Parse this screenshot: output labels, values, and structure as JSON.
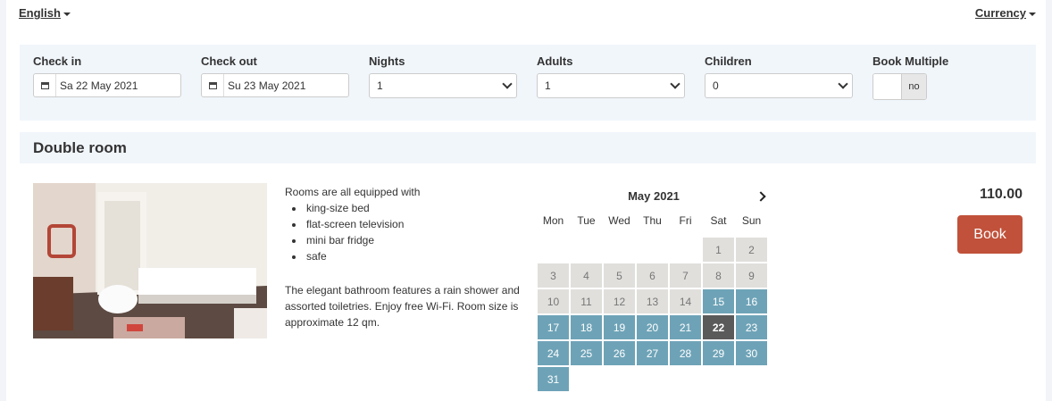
{
  "header": {
    "language": "English",
    "currency": "Currency"
  },
  "search": {
    "checkin": {
      "label": "Check in",
      "value": "Sa 22 May 2021"
    },
    "checkout": {
      "label": "Check out",
      "value": "Su 23 May 2021"
    },
    "nights": {
      "label": "Nights",
      "value": "1"
    },
    "adults": {
      "label": "Adults",
      "value": "1"
    },
    "children": {
      "label": "Children",
      "value": "0"
    },
    "book_multiple": {
      "label": "Book Multiple",
      "value": "no"
    }
  },
  "room": {
    "title": "Double room",
    "intro": "Rooms are all equipped with",
    "amenities": [
      "king-size bed",
      "flat-screen television",
      "mini bar fridge",
      "safe"
    ],
    "description": "The elegant bathroom features a rain shower and assorted toiletries. Enjoy free Wi-Fi. Room size is approximate 12 qm.",
    "price": "110.00",
    "book_label": "Book"
  },
  "calendar": {
    "title": "May 2021",
    "weekdays": [
      "Mon",
      "Tue",
      "Wed",
      "Thu",
      "Fri",
      "Sat",
      "Sun"
    ],
    "weeks": [
      [
        "",
        "",
        "",
        "",
        "",
        "1",
        "2"
      ],
      [
        "3",
        "4",
        "5",
        "6",
        "7",
        "8",
        "9"
      ],
      [
        "10",
        "11",
        "12",
        "13",
        "14",
        "15",
        "16"
      ],
      [
        "17",
        "18",
        "19",
        "20",
        "21",
        "22",
        "23"
      ],
      [
        "24",
        "25",
        "26",
        "27",
        "28",
        "29",
        "30"
      ],
      [
        "31",
        "",
        "",
        "",
        "",
        "",
        ""
      ]
    ],
    "first_available_day": 15,
    "selected_day": 22,
    "colors": {
      "past": "#e0dfdc",
      "available": "#6ea3b7",
      "selected": "#5a5a5a"
    }
  },
  "colors": {
    "panel": "#f1f6fb",
    "book_button": "#c1513a"
  }
}
